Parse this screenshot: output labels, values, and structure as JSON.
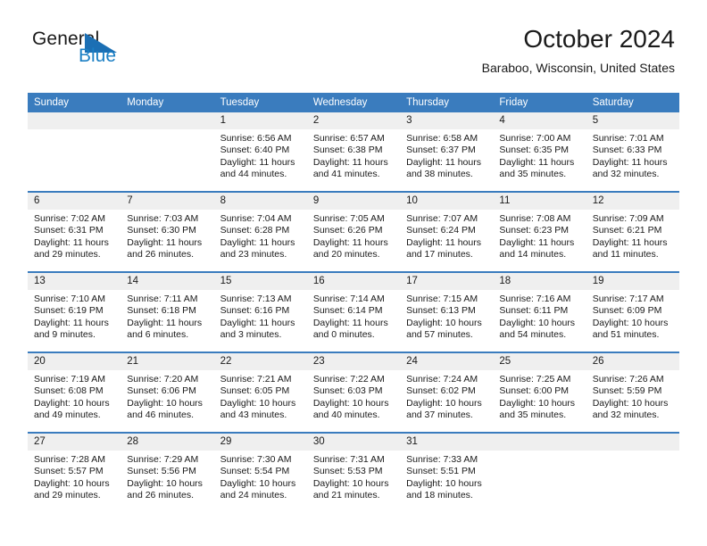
{
  "brand": {
    "name_part1": "General",
    "name_part2": "Blue",
    "flag_icon": "blue-triangle-flag-icon",
    "accent_color": "#1b7fc4"
  },
  "header": {
    "title": "October 2024",
    "subtitle": "Baraboo, Wisconsin, United States"
  },
  "theme": {
    "header_row_bg": "#3a7cbe",
    "daynum_band_bg": "#efefef",
    "week_separator": "#3a7cbe",
    "text": "#1a1a1a"
  },
  "calendar": {
    "weekday_headers": [
      "Sunday",
      "Monday",
      "Tuesday",
      "Wednesday",
      "Thursday",
      "Friday",
      "Saturday"
    ],
    "weeks": [
      [
        {
          "day": "",
          "sunrise": "",
          "sunset": "",
          "daylight_line1": "",
          "daylight_line2": ""
        },
        {
          "day": "",
          "sunrise": "",
          "sunset": "",
          "daylight_line1": "",
          "daylight_line2": ""
        },
        {
          "day": "1",
          "sunrise": "Sunrise: 6:56 AM",
          "sunset": "Sunset: 6:40 PM",
          "daylight_line1": "Daylight: 11 hours",
          "daylight_line2": "and 44 minutes."
        },
        {
          "day": "2",
          "sunrise": "Sunrise: 6:57 AM",
          "sunset": "Sunset: 6:38 PM",
          "daylight_line1": "Daylight: 11 hours",
          "daylight_line2": "and 41 minutes."
        },
        {
          "day": "3",
          "sunrise": "Sunrise: 6:58 AM",
          "sunset": "Sunset: 6:37 PM",
          "daylight_line1": "Daylight: 11 hours",
          "daylight_line2": "and 38 minutes."
        },
        {
          "day": "4",
          "sunrise": "Sunrise: 7:00 AM",
          "sunset": "Sunset: 6:35 PM",
          "daylight_line1": "Daylight: 11 hours",
          "daylight_line2": "and 35 minutes."
        },
        {
          "day": "5",
          "sunrise": "Sunrise: 7:01 AM",
          "sunset": "Sunset: 6:33 PM",
          "daylight_line1": "Daylight: 11 hours",
          "daylight_line2": "and 32 minutes."
        }
      ],
      [
        {
          "day": "6",
          "sunrise": "Sunrise: 7:02 AM",
          "sunset": "Sunset: 6:31 PM",
          "daylight_line1": "Daylight: 11 hours",
          "daylight_line2": "and 29 minutes."
        },
        {
          "day": "7",
          "sunrise": "Sunrise: 7:03 AM",
          "sunset": "Sunset: 6:30 PM",
          "daylight_line1": "Daylight: 11 hours",
          "daylight_line2": "and 26 minutes."
        },
        {
          "day": "8",
          "sunrise": "Sunrise: 7:04 AM",
          "sunset": "Sunset: 6:28 PM",
          "daylight_line1": "Daylight: 11 hours",
          "daylight_line2": "and 23 minutes."
        },
        {
          "day": "9",
          "sunrise": "Sunrise: 7:05 AM",
          "sunset": "Sunset: 6:26 PM",
          "daylight_line1": "Daylight: 11 hours",
          "daylight_line2": "and 20 minutes."
        },
        {
          "day": "10",
          "sunrise": "Sunrise: 7:07 AM",
          "sunset": "Sunset: 6:24 PM",
          "daylight_line1": "Daylight: 11 hours",
          "daylight_line2": "and 17 minutes."
        },
        {
          "day": "11",
          "sunrise": "Sunrise: 7:08 AM",
          "sunset": "Sunset: 6:23 PM",
          "daylight_line1": "Daylight: 11 hours",
          "daylight_line2": "and 14 minutes."
        },
        {
          "day": "12",
          "sunrise": "Sunrise: 7:09 AM",
          "sunset": "Sunset: 6:21 PM",
          "daylight_line1": "Daylight: 11 hours",
          "daylight_line2": "and 11 minutes."
        }
      ],
      [
        {
          "day": "13",
          "sunrise": "Sunrise: 7:10 AM",
          "sunset": "Sunset: 6:19 PM",
          "daylight_line1": "Daylight: 11 hours",
          "daylight_line2": "and 9 minutes."
        },
        {
          "day": "14",
          "sunrise": "Sunrise: 7:11 AM",
          "sunset": "Sunset: 6:18 PM",
          "daylight_line1": "Daylight: 11 hours",
          "daylight_line2": "and 6 minutes."
        },
        {
          "day": "15",
          "sunrise": "Sunrise: 7:13 AM",
          "sunset": "Sunset: 6:16 PM",
          "daylight_line1": "Daylight: 11 hours",
          "daylight_line2": "and 3 minutes."
        },
        {
          "day": "16",
          "sunrise": "Sunrise: 7:14 AM",
          "sunset": "Sunset: 6:14 PM",
          "daylight_line1": "Daylight: 11 hours",
          "daylight_line2": "and 0 minutes."
        },
        {
          "day": "17",
          "sunrise": "Sunrise: 7:15 AM",
          "sunset": "Sunset: 6:13 PM",
          "daylight_line1": "Daylight: 10 hours",
          "daylight_line2": "and 57 minutes."
        },
        {
          "day": "18",
          "sunrise": "Sunrise: 7:16 AM",
          "sunset": "Sunset: 6:11 PM",
          "daylight_line1": "Daylight: 10 hours",
          "daylight_line2": "and 54 minutes."
        },
        {
          "day": "19",
          "sunrise": "Sunrise: 7:17 AM",
          "sunset": "Sunset: 6:09 PM",
          "daylight_line1": "Daylight: 10 hours",
          "daylight_line2": "and 51 minutes."
        }
      ],
      [
        {
          "day": "20",
          "sunrise": "Sunrise: 7:19 AM",
          "sunset": "Sunset: 6:08 PM",
          "daylight_line1": "Daylight: 10 hours",
          "daylight_line2": "and 49 minutes."
        },
        {
          "day": "21",
          "sunrise": "Sunrise: 7:20 AM",
          "sunset": "Sunset: 6:06 PM",
          "daylight_line1": "Daylight: 10 hours",
          "daylight_line2": "and 46 minutes."
        },
        {
          "day": "22",
          "sunrise": "Sunrise: 7:21 AM",
          "sunset": "Sunset: 6:05 PM",
          "daylight_line1": "Daylight: 10 hours",
          "daylight_line2": "and 43 minutes."
        },
        {
          "day": "23",
          "sunrise": "Sunrise: 7:22 AM",
          "sunset": "Sunset: 6:03 PM",
          "daylight_line1": "Daylight: 10 hours",
          "daylight_line2": "and 40 minutes."
        },
        {
          "day": "24",
          "sunrise": "Sunrise: 7:24 AM",
          "sunset": "Sunset: 6:02 PM",
          "daylight_line1": "Daylight: 10 hours",
          "daylight_line2": "and 37 minutes."
        },
        {
          "day": "25",
          "sunrise": "Sunrise: 7:25 AM",
          "sunset": "Sunset: 6:00 PM",
          "daylight_line1": "Daylight: 10 hours",
          "daylight_line2": "and 35 minutes."
        },
        {
          "day": "26",
          "sunrise": "Sunrise: 7:26 AM",
          "sunset": "Sunset: 5:59 PM",
          "daylight_line1": "Daylight: 10 hours",
          "daylight_line2": "and 32 minutes."
        }
      ],
      [
        {
          "day": "27",
          "sunrise": "Sunrise: 7:28 AM",
          "sunset": "Sunset: 5:57 PM",
          "daylight_line1": "Daylight: 10 hours",
          "daylight_line2": "and 29 minutes."
        },
        {
          "day": "28",
          "sunrise": "Sunrise: 7:29 AM",
          "sunset": "Sunset: 5:56 PM",
          "daylight_line1": "Daylight: 10 hours",
          "daylight_line2": "and 26 minutes."
        },
        {
          "day": "29",
          "sunrise": "Sunrise: 7:30 AM",
          "sunset": "Sunset: 5:54 PM",
          "daylight_line1": "Daylight: 10 hours",
          "daylight_line2": "and 24 minutes."
        },
        {
          "day": "30",
          "sunrise": "Sunrise: 7:31 AM",
          "sunset": "Sunset: 5:53 PM",
          "daylight_line1": "Daylight: 10 hours",
          "daylight_line2": "and 21 minutes."
        },
        {
          "day": "31",
          "sunrise": "Sunrise: 7:33 AM",
          "sunset": "Sunset: 5:51 PM",
          "daylight_line1": "Daylight: 10 hours",
          "daylight_line2": "and 18 minutes."
        },
        {
          "day": "",
          "sunrise": "",
          "sunset": "",
          "daylight_line1": "",
          "daylight_line2": ""
        },
        {
          "day": "",
          "sunrise": "",
          "sunset": "",
          "daylight_line1": "",
          "daylight_line2": ""
        }
      ]
    ]
  }
}
